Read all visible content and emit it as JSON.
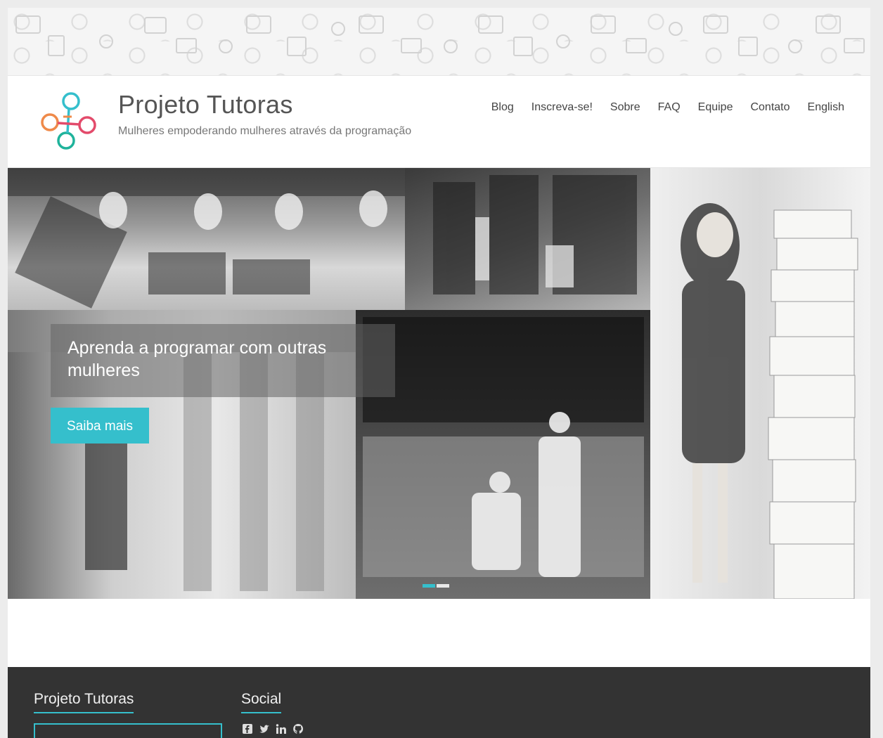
{
  "site": {
    "title": "Projeto Tutoras",
    "tagline": "Mulheres empoderando mulheres através da programação"
  },
  "nav": {
    "items": [
      "Blog",
      "Inscreva-se!",
      "Sobre",
      "FAQ",
      "Equipe",
      "Contato",
      "English"
    ]
  },
  "hero": {
    "caption": "Aprenda a programar com outras mulheres",
    "cta_label": "Saiba mais",
    "slide_count": 2,
    "active_slide": 1
  },
  "footer": {
    "col1_title": "Projeto Tutoras",
    "col2_title": "Social",
    "social_icons": [
      "facebook-icon",
      "twitter-icon",
      "linkedin-icon",
      "github-icon"
    ]
  },
  "colors": {
    "accent": "#35bfcc",
    "logo_orange": "#ef8a4a",
    "logo_pink": "#e34b6b",
    "logo_teal": "#1fb39b",
    "logo_cyan": "#35bfcc",
    "footer_bg": "#333333"
  }
}
